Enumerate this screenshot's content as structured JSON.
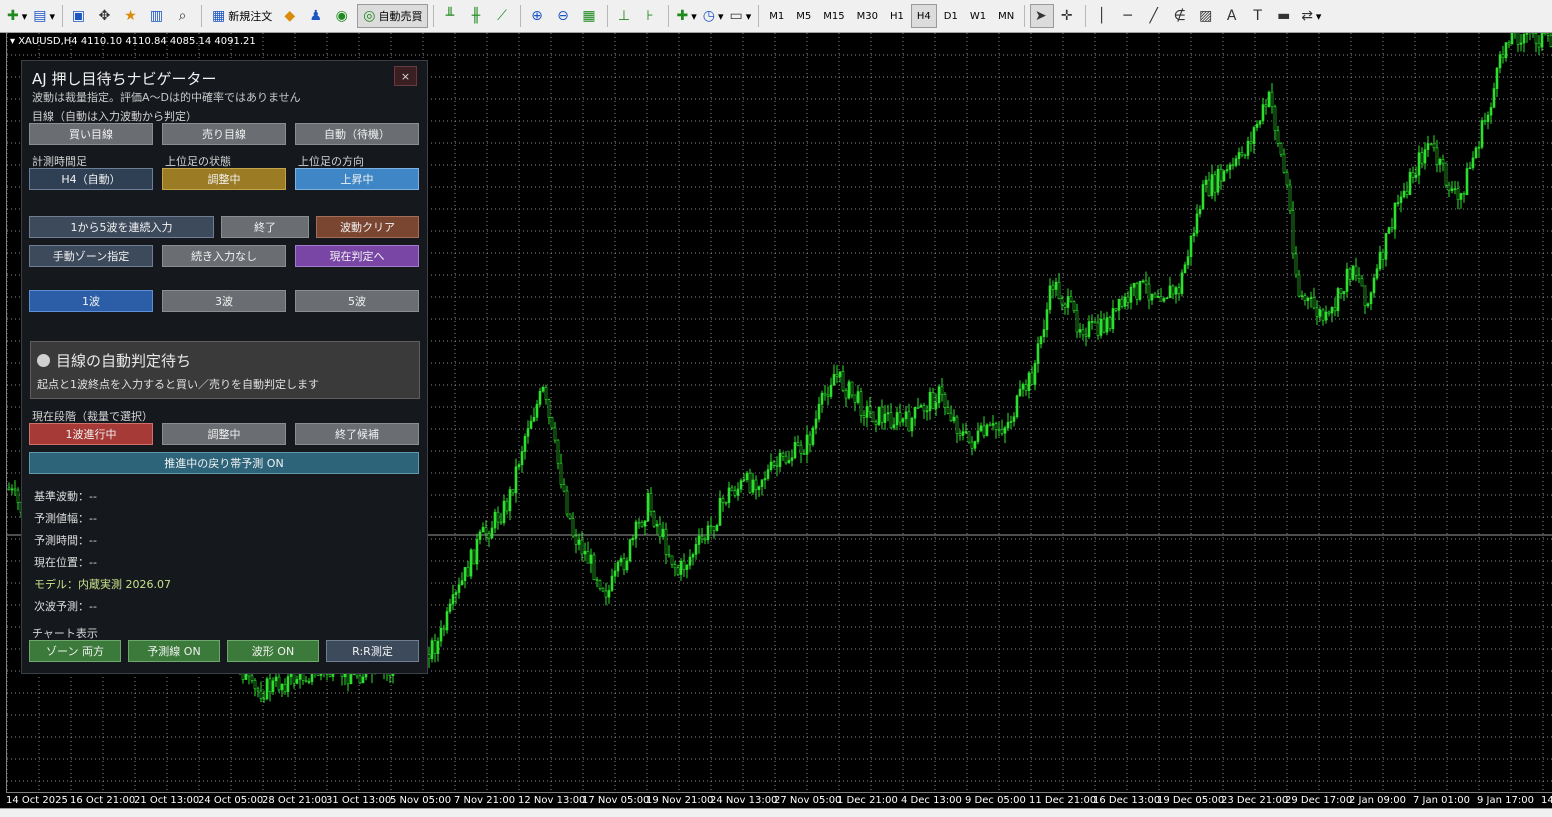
{
  "toolbar": {
    "new_order": "新規注文",
    "auto_trade": "自動売買",
    "timeframes": [
      "M1",
      "M5",
      "M15",
      "M30",
      "H1",
      "H4",
      "D1",
      "W1",
      "MN"
    ],
    "active_timeframe": "H4"
  },
  "chart": {
    "info": "XAUUSD,H4  4110.10 4110.84 4085.14 4091.21",
    "candle_color": "#2de02d",
    "grid_color": "#8a8a8a",
    "time_labels": [
      "14 Oct 2025",
      "16 Oct 21:00",
      "21 Oct 13:00",
      "24 Oct 05:00",
      "28 Oct 21:00",
      "31 Oct 13:00",
      "5 Nov 05:00",
      "7 Nov 21:00",
      "12 Nov 13:00",
      "17 Nov 05:00",
      "19 Nov 21:00",
      "24 Nov 13:00",
      "27 Nov 05:00",
      "1 Dec 21:00",
      "4 Dec 13:00",
      "9 Dec 05:00",
      "11 Dec 21:00",
      "16 Dec 13:00",
      "19 Dec 05:00",
      "23 Dec 21:00",
      "29 Dec 17:00",
      "2 Jan 09:00",
      "7 Jan 01:00",
      "9 Jan 17:00",
      "14"
    ]
  },
  "panel": {
    "title": "AJ 押し目待ちナビゲーター",
    "subtitle": "波動は裁量指定。評価A〜Dは的中確率ではありません",
    "close_label": "×",
    "bias_label": "目線（自動は入力波動から判定）",
    "bias_buttons": [
      "買い目線",
      "売り目線",
      "自動（待機）"
    ],
    "tf_label": "計測時間足",
    "tf_value": "H4（自動）",
    "upper_state_label": "上位足の状態",
    "upper_state_value": "調整中",
    "upper_dir_label": "上位足の方向",
    "upper_dir_value": "上昇中",
    "wave_input": "1から5波を連続入力",
    "finish": "終了",
    "wave_clear": "波動クリア",
    "manual_zone": "手動ゾーン指定",
    "no_continue": "続き入力なし",
    "to_current": "現在判定へ",
    "wave_buttons": [
      "1波",
      "3波",
      "5波"
    ],
    "status_title": "目線の自動判定待ち",
    "status_desc": "起点と1波終点を入力すると買い／売りを自動判定します",
    "phase_label": "現在段階（裁量で選択）",
    "phase_buttons": [
      "1波進行中",
      "調整中",
      "終了候補"
    ],
    "pullback_forecast": "推進中の戻り帯予測 ON",
    "info": {
      "base_wave": "基準波動：--",
      "forecast_range": "予測値幅：--",
      "forecast_time": "予測時間：--",
      "current_pos": "現在位置：--",
      "model": "モデル：内蔵実測 2026.07",
      "next_wave": "次波予測：--"
    },
    "chart_display_label": "チャート表示",
    "chart_buttons": [
      "ゾーン 両方",
      "予測線 ON",
      "波形 ON",
      "R:R測定"
    ]
  }
}
